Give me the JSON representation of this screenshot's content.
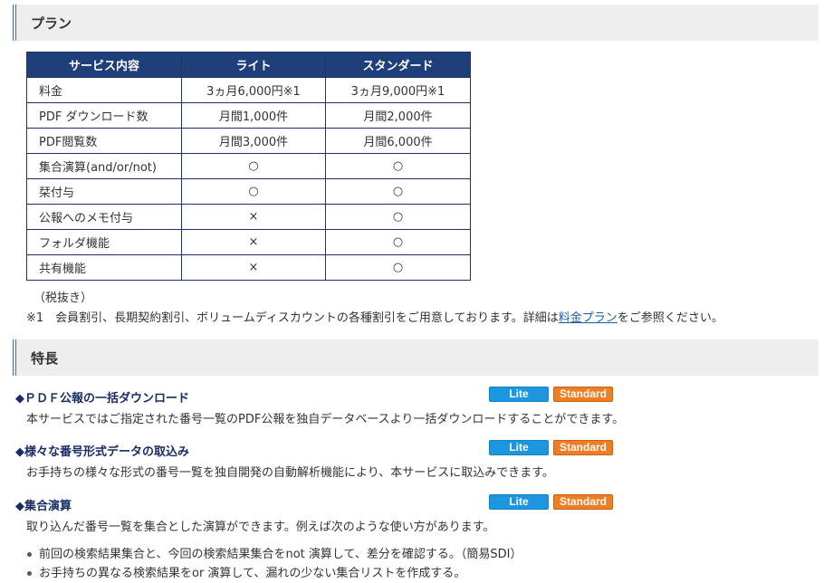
{
  "plan_section": {
    "title": "プラン",
    "table": {
      "headers": [
        "サービス内容",
        "ライト",
        "スタンダード"
      ],
      "rows": [
        [
          "料金",
          "3ヵ月6,000円※1",
          "3ヵ月9,000円※1"
        ],
        [
          "PDF ダウンロード数",
          "月間1,000件",
          "月間2,000件"
        ],
        [
          "PDF閲覧数",
          "月間3,000件",
          "月間6,000件"
        ],
        [
          "集合演算(and/or/not)",
          "○",
          "○"
        ],
        [
          "栞付与",
          "○",
          "○"
        ],
        [
          "公報へのメモ付与",
          "×",
          "○"
        ],
        [
          "フォルダ機能",
          "×",
          "○"
        ],
        [
          "共有機能",
          "×",
          "○"
        ]
      ]
    },
    "note_tax": "（税抜き）",
    "note_1_before": "※1　会員割引、長期契約割引、ボリュームディスカウントの各種割引をご用意しております。詳細は",
    "note_1_link": "料金プラン",
    "note_1_after": "をご参照ください。"
  },
  "features_section": {
    "title": "特長",
    "badge_lite": "Lite",
    "badge_standard": "Standard",
    "features": [
      {
        "title": "◆ＰＤＦ公報の一括ダウンロード",
        "desc": "本サービスではご指定された番号一覧のPDF公報を独自データベースより一括ダウンロードすることができます。"
      },
      {
        "title": "◆様々な番号形式データの取込み",
        "desc": "お手持ちの様々な形式の番号一覧を独自開発の自動解析機能により、本サービスに取込みできます。"
      },
      {
        "title": "◆集合演算",
        "desc": "取り込んだ番号一覧を集合とした演算ができます。例えば次のような使い方があります。"
      }
    ],
    "uses": [
      "前回の検索結果集合と、今回の検索結果集合をnot 演算して、差分を確認する。（簡易SDI）",
      "お手持ちの異なる検索結果をor 演算して、漏れの少ない集合リストを作成する。"
    ]
  },
  "colors": {
    "table_header": "#1f3f7a",
    "badge_lite": "#1d96e0",
    "badge_standard": "#ef7d22",
    "feature_title": "#1a2c66",
    "link": "#1a5fa8"
  }
}
